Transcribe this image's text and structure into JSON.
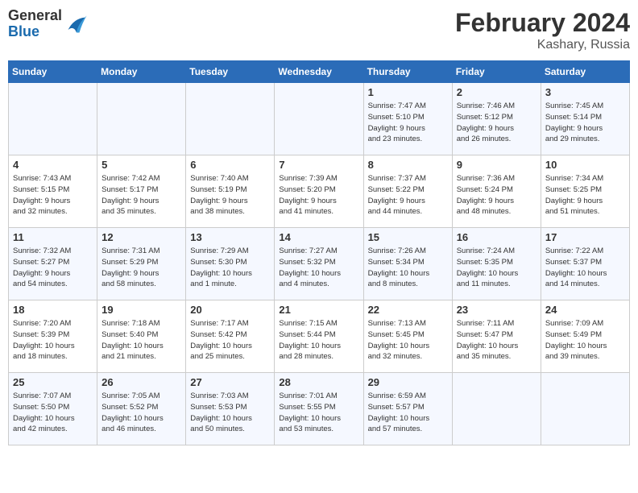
{
  "header": {
    "logo_general": "General",
    "logo_blue": "Blue",
    "month_year": "February 2024",
    "location": "Kashary, Russia"
  },
  "weekdays": [
    "Sunday",
    "Monday",
    "Tuesday",
    "Wednesday",
    "Thursday",
    "Friday",
    "Saturday"
  ],
  "weeks": [
    [
      {
        "day": "",
        "info": ""
      },
      {
        "day": "",
        "info": ""
      },
      {
        "day": "",
        "info": ""
      },
      {
        "day": "",
        "info": ""
      },
      {
        "day": "1",
        "info": "Sunrise: 7:47 AM\nSunset: 5:10 PM\nDaylight: 9 hours\nand 23 minutes."
      },
      {
        "day": "2",
        "info": "Sunrise: 7:46 AM\nSunset: 5:12 PM\nDaylight: 9 hours\nand 26 minutes."
      },
      {
        "day": "3",
        "info": "Sunrise: 7:45 AM\nSunset: 5:14 PM\nDaylight: 9 hours\nand 29 minutes."
      }
    ],
    [
      {
        "day": "4",
        "info": "Sunrise: 7:43 AM\nSunset: 5:15 PM\nDaylight: 9 hours\nand 32 minutes."
      },
      {
        "day": "5",
        "info": "Sunrise: 7:42 AM\nSunset: 5:17 PM\nDaylight: 9 hours\nand 35 minutes."
      },
      {
        "day": "6",
        "info": "Sunrise: 7:40 AM\nSunset: 5:19 PM\nDaylight: 9 hours\nand 38 minutes."
      },
      {
        "day": "7",
        "info": "Sunrise: 7:39 AM\nSunset: 5:20 PM\nDaylight: 9 hours\nand 41 minutes."
      },
      {
        "day": "8",
        "info": "Sunrise: 7:37 AM\nSunset: 5:22 PM\nDaylight: 9 hours\nand 44 minutes."
      },
      {
        "day": "9",
        "info": "Sunrise: 7:36 AM\nSunset: 5:24 PM\nDaylight: 9 hours\nand 48 minutes."
      },
      {
        "day": "10",
        "info": "Sunrise: 7:34 AM\nSunset: 5:25 PM\nDaylight: 9 hours\nand 51 minutes."
      }
    ],
    [
      {
        "day": "11",
        "info": "Sunrise: 7:32 AM\nSunset: 5:27 PM\nDaylight: 9 hours\nand 54 minutes."
      },
      {
        "day": "12",
        "info": "Sunrise: 7:31 AM\nSunset: 5:29 PM\nDaylight: 9 hours\nand 58 minutes."
      },
      {
        "day": "13",
        "info": "Sunrise: 7:29 AM\nSunset: 5:30 PM\nDaylight: 10 hours\nand 1 minute."
      },
      {
        "day": "14",
        "info": "Sunrise: 7:27 AM\nSunset: 5:32 PM\nDaylight: 10 hours\nand 4 minutes."
      },
      {
        "day": "15",
        "info": "Sunrise: 7:26 AM\nSunset: 5:34 PM\nDaylight: 10 hours\nand 8 minutes."
      },
      {
        "day": "16",
        "info": "Sunrise: 7:24 AM\nSunset: 5:35 PM\nDaylight: 10 hours\nand 11 minutes."
      },
      {
        "day": "17",
        "info": "Sunrise: 7:22 AM\nSunset: 5:37 PM\nDaylight: 10 hours\nand 14 minutes."
      }
    ],
    [
      {
        "day": "18",
        "info": "Sunrise: 7:20 AM\nSunset: 5:39 PM\nDaylight: 10 hours\nand 18 minutes."
      },
      {
        "day": "19",
        "info": "Sunrise: 7:18 AM\nSunset: 5:40 PM\nDaylight: 10 hours\nand 21 minutes."
      },
      {
        "day": "20",
        "info": "Sunrise: 7:17 AM\nSunset: 5:42 PM\nDaylight: 10 hours\nand 25 minutes."
      },
      {
        "day": "21",
        "info": "Sunrise: 7:15 AM\nSunset: 5:44 PM\nDaylight: 10 hours\nand 28 minutes."
      },
      {
        "day": "22",
        "info": "Sunrise: 7:13 AM\nSunset: 5:45 PM\nDaylight: 10 hours\nand 32 minutes."
      },
      {
        "day": "23",
        "info": "Sunrise: 7:11 AM\nSunset: 5:47 PM\nDaylight: 10 hours\nand 35 minutes."
      },
      {
        "day": "24",
        "info": "Sunrise: 7:09 AM\nSunset: 5:49 PM\nDaylight: 10 hours\nand 39 minutes."
      }
    ],
    [
      {
        "day": "25",
        "info": "Sunrise: 7:07 AM\nSunset: 5:50 PM\nDaylight: 10 hours\nand 42 minutes."
      },
      {
        "day": "26",
        "info": "Sunrise: 7:05 AM\nSunset: 5:52 PM\nDaylight: 10 hours\nand 46 minutes."
      },
      {
        "day": "27",
        "info": "Sunrise: 7:03 AM\nSunset: 5:53 PM\nDaylight: 10 hours\nand 50 minutes."
      },
      {
        "day": "28",
        "info": "Sunrise: 7:01 AM\nSunset: 5:55 PM\nDaylight: 10 hours\nand 53 minutes."
      },
      {
        "day": "29",
        "info": "Sunrise: 6:59 AM\nSunset: 5:57 PM\nDaylight: 10 hours\nand 57 minutes."
      },
      {
        "day": "",
        "info": ""
      },
      {
        "day": "",
        "info": ""
      }
    ]
  ]
}
